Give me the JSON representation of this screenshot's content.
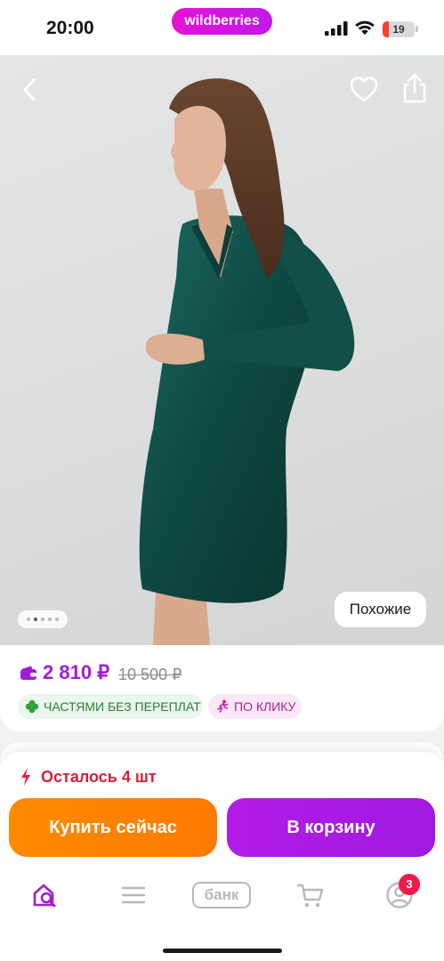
{
  "status_bar": {
    "time": "20:00",
    "brand": "wildberries",
    "battery": "19",
    "battery_level": 0.19
  },
  "hero": {
    "image_count": 5,
    "active_image_index": 1,
    "similar_label": "Похожие"
  },
  "price": {
    "current": "2 810 ₽",
    "old": "10 500 ₽",
    "badges": [
      "ЧАСТЯМИ БЕЗ ПЕРЕПЛАТ",
      "ПО КЛИКУ"
    ]
  },
  "actions": {
    "stock": "Осталось 4 шт",
    "buy_now": "Купить сейчас",
    "add_to_cart": "В корзину"
  },
  "tab_bar": {
    "bank_label": "банк",
    "profile_badge": "3"
  },
  "colors": {
    "brand": "#cb11ab",
    "price": "#a21cd8",
    "buy_now": "#ff7f00",
    "add_to_cart": "#a51be4",
    "stock_warning": "#d61f37",
    "dress": "#0f4a44"
  },
  "icons": [
    "signal-icon",
    "wifi-icon",
    "battery-icon",
    "back-icon",
    "heart-icon",
    "share-icon",
    "wallet-icon",
    "clover-icon",
    "runner-icon",
    "lightning-icon",
    "home-search-icon",
    "menu-icon",
    "bank-icon",
    "cart-icon",
    "profile-icon"
  ]
}
